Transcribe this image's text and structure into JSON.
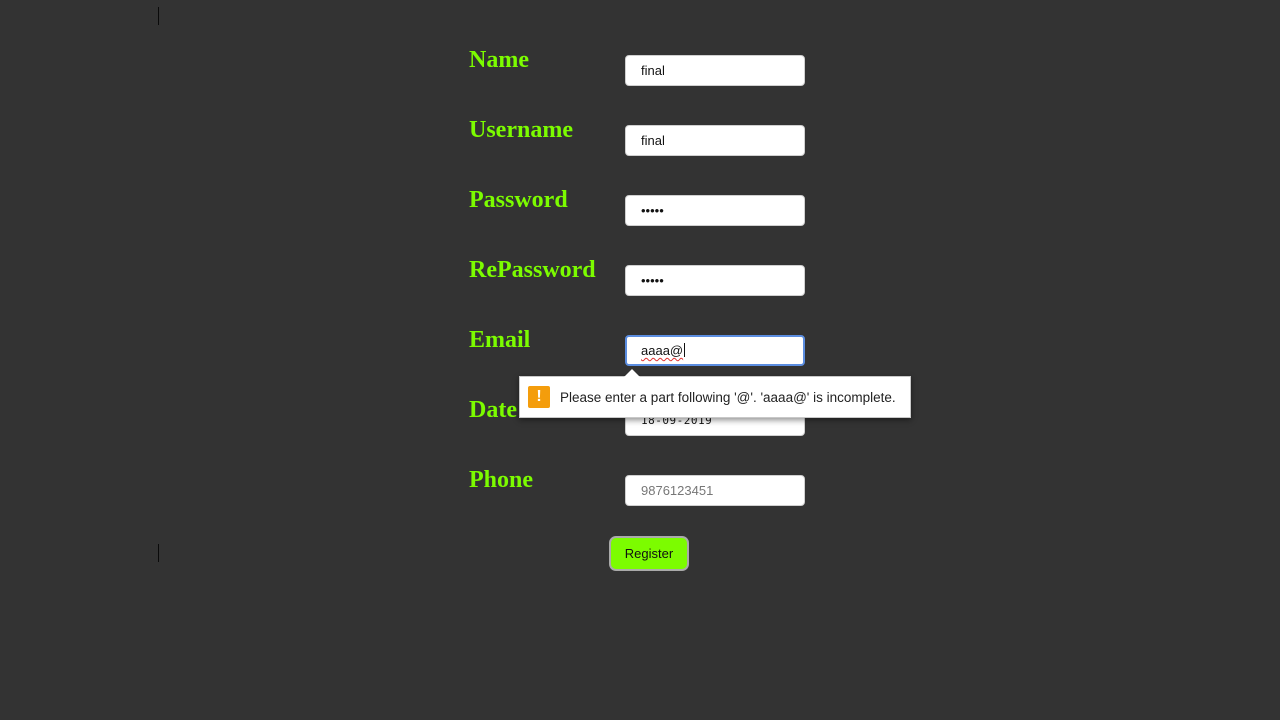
{
  "form": {
    "name": {
      "label": "Name",
      "value": "final"
    },
    "username": {
      "label": "Username",
      "value": "final"
    },
    "password": {
      "label": "Password",
      "value": "•••••"
    },
    "repassword": {
      "label": "RePassword",
      "value": "•••••"
    },
    "email": {
      "label": "Email",
      "value": "aaaa@"
    },
    "date": {
      "label": "Date",
      "value": "18-09-2019"
    },
    "phone": {
      "label": "Phone",
      "placeholder": "9876123451"
    },
    "register_label": "Register"
  },
  "validation_tooltip": {
    "icon": "warning-icon",
    "icon_glyph": "!",
    "message": "Please enter a part following '@'. 'aaaa@' is incomplete."
  },
  "colors": {
    "background": "#333333",
    "label": "#7cfc00",
    "register_button": "#7cfc00",
    "warning": "#f49d0c",
    "focus_border": "#5b8de0"
  }
}
